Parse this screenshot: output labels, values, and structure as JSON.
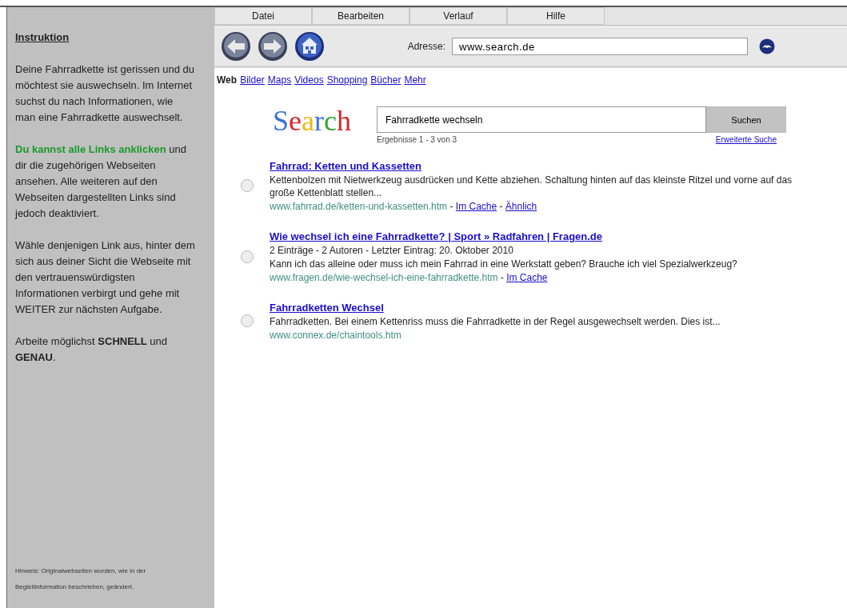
{
  "sidebar": {
    "title": "Instruktion",
    "paragraphs": [
      {
        "kind": "plain",
        "text": "Deine Fahrradkette ist gerissen und du möchtest sie auswechseln. Im Internet suchst du nach Informationen, wie man eine Fahrradkette auswechselt."
      },
      {
        "kind": "highlight",
        "text": "**Du kannst alle Links anklicken** und dir die zugehörigen Webseiten ansehen. Alle weiteren auf den Webseiten dargestellten Links sind jedoch deaktiviert."
      },
      {
        "kind": "plain",
        "text": "Wähle denjenigen Link aus, hinter dem sich aus deiner Sicht die Webseite mit den vertrauenswürdigsten Informationen verbirgt und gehe mit WEITER zur nächsten Aufgabe."
      },
      {
        "kind": "plain",
        "text": "Arbeite möglichst **SCHNELL** und **GENAU**."
      }
    ],
    "note": "Hinweis: Originalwebseiten wurden, wie in der Begleitinformation beschrieben, geändert."
  },
  "menu": [
    "Datei",
    "Bearbeiten",
    "Verlauf",
    "Hilfe"
  ],
  "address": {
    "label": "Adresse:",
    "value": "www.search.de"
  },
  "nav_tabs": [
    {
      "label": "Web",
      "selected": true
    },
    {
      "label": "Bilder",
      "selected": false
    },
    {
      "label": "Maps",
      "selected": false
    },
    {
      "label": "Videos",
      "selected": false
    },
    {
      "label": "Shopping",
      "selected": false
    },
    {
      "label": "Bücher",
      "selected": false
    },
    {
      "label": "Mehr",
      "selected": false
    }
  ],
  "search": {
    "logo": "Search",
    "value": "Fahrradkette wechseln",
    "button": "Suchen",
    "count": "Ergebnisse 1 - 3 von 3",
    "advanced": "Erweiterte Suche"
  },
  "results": [
    {
      "title": "Fahrrad: Ketten und Kassetten",
      "lines": [
        "Kettenbolzen mit Nietwerkzeug ausdrücken und Kette abziehen. Schaltung hinten auf das kleinste Ritzel und vorne auf das große Kettenblatt stellen..."
      ],
      "url": "www.fahrrad.de/ketten-und-kassetten.htm",
      "links": [
        {
          "sep": "-",
          "label": "Im Cache"
        },
        {
          "sep": "-",
          "label": "Ähnlich"
        }
      ],
      "selected": false
    },
    {
      "title": "Wie wechsel ich eine Fahrradkette? | Sport » Radfahren | Fragen.de",
      "lines": [
        "2 Einträge - 2 Autoren - Letzter Eintrag: 20. Oktober 2010",
        "Kann ich das alleine oder muss ich mein Fahrrad in eine Werkstatt geben? Brauche ich viel Spezialwerkzeug?"
      ],
      "url": "www.fragen.de/wie-wechsel-ich-eine-fahrradkette.htm",
      "links": [
        {
          "sep": "-",
          "label": "Im Cache"
        }
      ],
      "selected": false
    },
    {
      "title": "Fahrradketten Wechsel",
      "lines": [
        "Fahrradketten. Bei einem Kettenriss muss die Fahrradkette in der Regel ausgewechselt werden. Dies ist..."
      ],
      "url": "www.connex.de/chaintools.htm",
      "selected": false
    }
  ]
}
